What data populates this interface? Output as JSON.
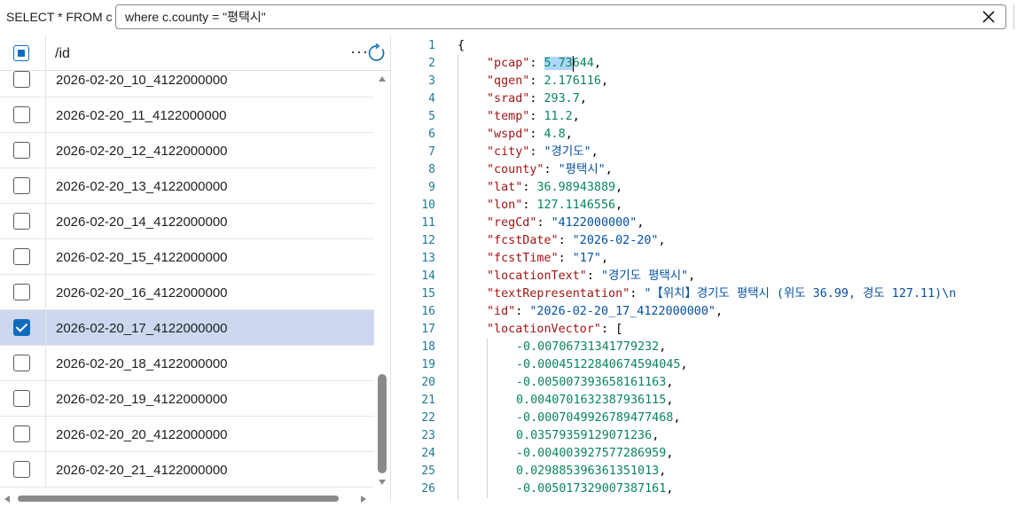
{
  "query": {
    "prefix": "SELECT * FROM c",
    "value": "where c.county = \"평택시\"",
    "clear_icon": "close-icon"
  },
  "results": {
    "column_header": "/id",
    "more_label": "···",
    "rows": [
      {
        "id": "2026-02-20_10_4122000000",
        "checked": false
      },
      {
        "id": "2026-02-20_11_4122000000",
        "checked": false
      },
      {
        "id": "2026-02-20_12_4122000000",
        "checked": false
      },
      {
        "id": "2026-02-20_13_4122000000",
        "checked": false
      },
      {
        "id": "2026-02-20_14_4122000000",
        "checked": false
      },
      {
        "id": "2026-02-20_15_4122000000",
        "checked": false
      },
      {
        "id": "2026-02-20_16_4122000000",
        "checked": false
      },
      {
        "id": "2026-02-20_17_4122000000",
        "checked": true
      },
      {
        "id": "2026-02-20_18_4122000000",
        "checked": false
      },
      {
        "id": "2026-02-20_19_4122000000",
        "checked": false
      },
      {
        "id": "2026-02-20_20_4122000000",
        "checked": false
      },
      {
        "id": "2026-02-20_21_4122000000",
        "checked": false
      }
    ]
  },
  "editor": {
    "lines": [
      {
        "num": "1",
        "indent": 0,
        "tokens": [
          {
            "t": "{",
            "c": "p"
          }
        ]
      },
      {
        "num": "2",
        "indent": 1,
        "tokens": [
          {
            "t": "\"pcap\"",
            "c": "k"
          },
          {
            "t": ": ",
            "c": "p"
          },
          {
            "t": "5.73",
            "c": "n",
            "hl": true
          },
          {
            "t": "644",
            "c": "n"
          },
          {
            "t": ",",
            "c": "p"
          }
        ]
      },
      {
        "num": "3",
        "indent": 1,
        "tokens": [
          {
            "t": "\"qgen\"",
            "c": "k"
          },
          {
            "t": ": ",
            "c": "p"
          },
          {
            "t": "2.176116",
            "c": "n"
          },
          {
            "t": ",",
            "c": "p"
          }
        ]
      },
      {
        "num": "4",
        "indent": 1,
        "tokens": [
          {
            "t": "\"srad\"",
            "c": "k"
          },
          {
            "t": ": ",
            "c": "p"
          },
          {
            "t": "293.7",
            "c": "n"
          },
          {
            "t": ",",
            "c": "p"
          }
        ]
      },
      {
        "num": "5",
        "indent": 1,
        "tokens": [
          {
            "t": "\"temp\"",
            "c": "k"
          },
          {
            "t": ": ",
            "c": "p"
          },
          {
            "t": "11.2",
            "c": "n"
          },
          {
            "t": ",",
            "c": "p"
          }
        ]
      },
      {
        "num": "6",
        "indent": 1,
        "tokens": [
          {
            "t": "\"wspd\"",
            "c": "k"
          },
          {
            "t": ": ",
            "c": "p"
          },
          {
            "t": "4.8",
            "c": "n"
          },
          {
            "t": ",",
            "c": "p"
          }
        ]
      },
      {
        "num": "7",
        "indent": 1,
        "tokens": [
          {
            "t": "\"city\"",
            "c": "k"
          },
          {
            "t": ": ",
            "c": "p"
          },
          {
            "t": "\"경기도\"",
            "c": "s"
          },
          {
            "t": ",",
            "c": "p"
          }
        ]
      },
      {
        "num": "8",
        "indent": 1,
        "tokens": [
          {
            "t": "\"county\"",
            "c": "k"
          },
          {
            "t": ": ",
            "c": "p"
          },
          {
            "t": "\"평택시\"",
            "c": "s"
          },
          {
            "t": ",",
            "c": "p"
          }
        ]
      },
      {
        "num": "9",
        "indent": 1,
        "tokens": [
          {
            "t": "\"lat\"",
            "c": "k"
          },
          {
            "t": ": ",
            "c": "p"
          },
          {
            "t": "36.98943889",
            "c": "n"
          },
          {
            "t": ",",
            "c": "p"
          }
        ]
      },
      {
        "num": "10",
        "indent": 1,
        "tokens": [
          {
            "t": "\"lon\"",
            "c": "k"
          },
          {
            "t": ": ",
            "c": "p"
          },
          {
            "t": "127.1146556",
            "c": "n"
          },
          {
            "t": ",",
            "c": "p"
          }
        ]
      },
      {
        "num": "11",
        "indent": 1,
        "tokens": [
          {
            "t": "\"regCd\"",
            "c": "k"
          },
          {
            "t": ": ",
            "c": "p"
          },
          {
            "t": "\"4122000000\"",
            "c": "s"
          },
          {
            "t": ",",
            "c": "p"
          }
        ]
      },
      {
        "num": "12",
        "indent": 1,
        "tokens": [
          {
            "t": "\"fcstDate\"",
            "c": "k"
          },
          {
            "t": ": ",
            "c": "p"
          },
          {
            "t": "\"2026-02-20\"",
            "c": "s"
          },
          {
            "t": ",",
            "c": "p"
          }
        ]
      },
      {
        "num": "13",
        "indent": 1,
        "tokens": [
          {
            "t": "\"fcstTime\"",
            "c": "k"
          },
          {
            "t": ": ",
            "c": "p"
          },
          {
            "t": "\"17\"",
            "c": "s"
          },
          {
            "t": ",",
            "c": "p"
          }
        ]
      },
      {
        "num": "14",
        "indent": 1,
        "tokens": [
          {
            "t": "\"locationText\"",
            "c": "k"
          },
          {
            "t": ": ",
            "c": "p"
          },
          {
            "t": "\"경기도 평택시\"",
            "c": "s"
          },
          {
            "t": ",",
            "c": "p"
          }
        ]
      },
      {
        "num": "15",
        "indent": 1,
        "tokens": [
          {
            "t": "\"textRepresentation\"",
            "c": "k"
          },
          {
            "t": ": ",
            "c": "p"
          },
          {
            "t": "\"【위치】경기도 평택시 (위도 36.99, 경도 127.11)\\n ",
            "c": "s"
          }
        ]
      },
      {
        "num": "16",
        "indent": 1,
        "tokens": [
          {
            "t": "\"id\"",
            "c": "k"
          },
          {
            "t": ": ",
            "c": "p"
          },
          {
            "t": "\"2026-02-20_17_4122000000\"",
            "c": "s"
          },
          {
            "t": ",",
            "c": "p"
          }
        ]
      },
      {
        "num": "17",
        "indent": 1,
        "tokens": [
          {
            "t": "\"locationVector\"",
            "c": "k"
          },
          {
            "t": ": [",
            "c": "p"
          }
        ]
      },
      {
        "num": "18",
        "indent": 2,
        "tokens": [
          {
            "t": "-0.00706731341779232",
            "c": "n"
          },
          {
            "t": ",",
            "c": "p"
          }
        ]
      },
      {
        "num": "19",
        "indent": 2,
        "tokens": [
          {
            "t": "-0.00045122840674594045",
            "c": "n"
          },
          {
            "t": ",",
            "c": "p"
          }
        ]
      },
      {
        "num": "20",
        "indent": 2,
        "tokens": [
          {
            "t": "-0.005007393658161163",
            "c": "n"
          },
          {
            "t": ",",
            "c": "p"
          }
        ]
      },
      {
        "num": "21",
        "indent": 2,
        "tokens": [
          {
            "t": "0.0040701632387936115",
            "c": "n"
          },
          {
            "t": ",",
            "c": "p"
          }
        ]
      },
      {
        "num": "22",
        "indent": 2,
        "tokens": [
          {
            "t": "-0.0007049926789477468",
            "c": "n"
          },
          {
            "t": ",",
            "c": "p"
          }
        ]
      },
      {
        "num": "23",
        "indent": 2,
        "tokens": [
          {
            "t": "0.03579359129071236",
            "c": "n"
          },
          {
            "t": ",",
            "c": "p"
          }
        ]
      },
      {
        "num": "24",
        "indent": 2,
        "tokens": [
          {
            "t": "-0.004003927577286959",
            "c": "n"
          },
          {
            "t": ",",
            "c": "p"
          }
        ]
      },
      {
        "num": "25",
        "indent": 2,
        "tokens": [
          {
            "t": "0.029885396361351013",
            "c": "n"
          },
          {
            "t": ",",
            "c": "p"
          }
        ]
      },
      {
        "num": "26",
        "indent": 2,
        "tokens": [
          {
            "t": "-0.005017329007387161",
            "c": "n"
          },
          {
            "t": ",",
            "c": "p"
          }
        ]
      }
    ]
  },
  "colors": {
    "accent": "#0f6cbd",
    "selected_row": "#cdd8ef",
    "json_key": "#a31515",
    "json_number": "#098658",
    "json_string": "#0451a5",
    "line_number": "#237893",
    "selection_highlight": "#add6ff"
  }
}
